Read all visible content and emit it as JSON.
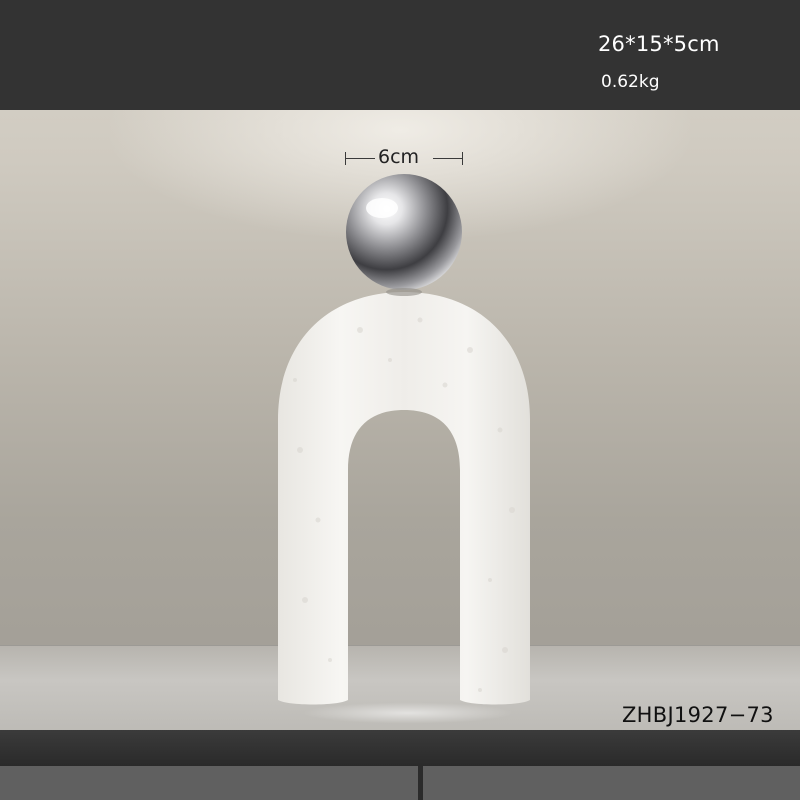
{
  "product": {
    "dimensions": "26*15*5cm",
    "weight": "0.62kg",
    "ball_width": "6cm",
    "code": "ZHBJ1927−73"
  },
  "colors": {
    "band": "#333333",
    "sculpture": "#f4f2ee",
    "ball": "#b9b9bb",
    "text_light": "#ffffff",
    "text_dark": "#111111"
  }
}
